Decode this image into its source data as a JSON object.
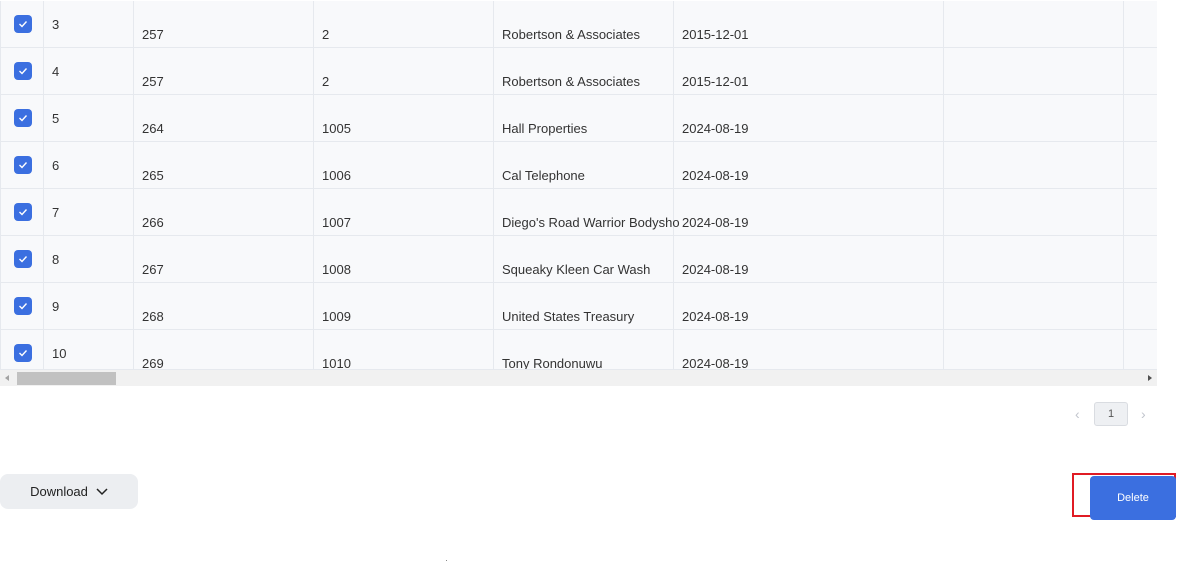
{
  "table": {
    "rows": [
      {
        "index": "3",
        "col2": "257",
        "col3": "2",
        "col4": "Robertson & Associates",
        "col5": "2015-12-01",
        "checked": true
      },
      {
        "index": "4",
        "col2": "257",
        "col3": "2",
        "col4": "Robertson & Associates",
        "col5": "2015-12-01",
        "checked": true
      },
      {
        "index": "5",
        "col2": "264",
        "col3": "1005",
        "col4": "Hall Properties",
        "col5": "2024-08-19",
        "checked": true
      },
      {
        "index": "6",
        "col2": "265",
        "col3": "1006",
        "col4": "Cal Telephone",
        "col5": "2024-08-19",
        "checked": true
      },
      {
        "index": "7",
        "col2": "266",
        "col3": "1007",
        "col4": "Diego's Road Warrior Bodyshop",
        "col5": "2024-08-19",
        "checked": true
      },
      {
        "index": "8",
        "col2": "267",
        "col3": "1008",
        "col4": "Squeaky Kleen Car Wash",
        "col5": "2024-08-19",
        "checked": true
      },
      {
        "index": "9",
        "col2": "268",
        "col3": "1009",
        "col4": "United States Treasury",
        "col5": "2024-08-19",
        "checked": true
      },
      {
        "index": "10",
        "col2": "269",
        "col3": "1010",
        "col4": "Tony Rondonuwu",
        "col5": "2024-08-19",
        "checked": true
      }
    ]
  },
  "pagination": {
    "prev": "‹",
    "current_page": "1",
    "next": "›"
  },
  "actions": {
    "download_label": "Download",
    "delete_label": "Delete"
  },
  "colors": {
    "accent": "#3b6fe0",
    "highlight": "#e01b24"
  }
}
